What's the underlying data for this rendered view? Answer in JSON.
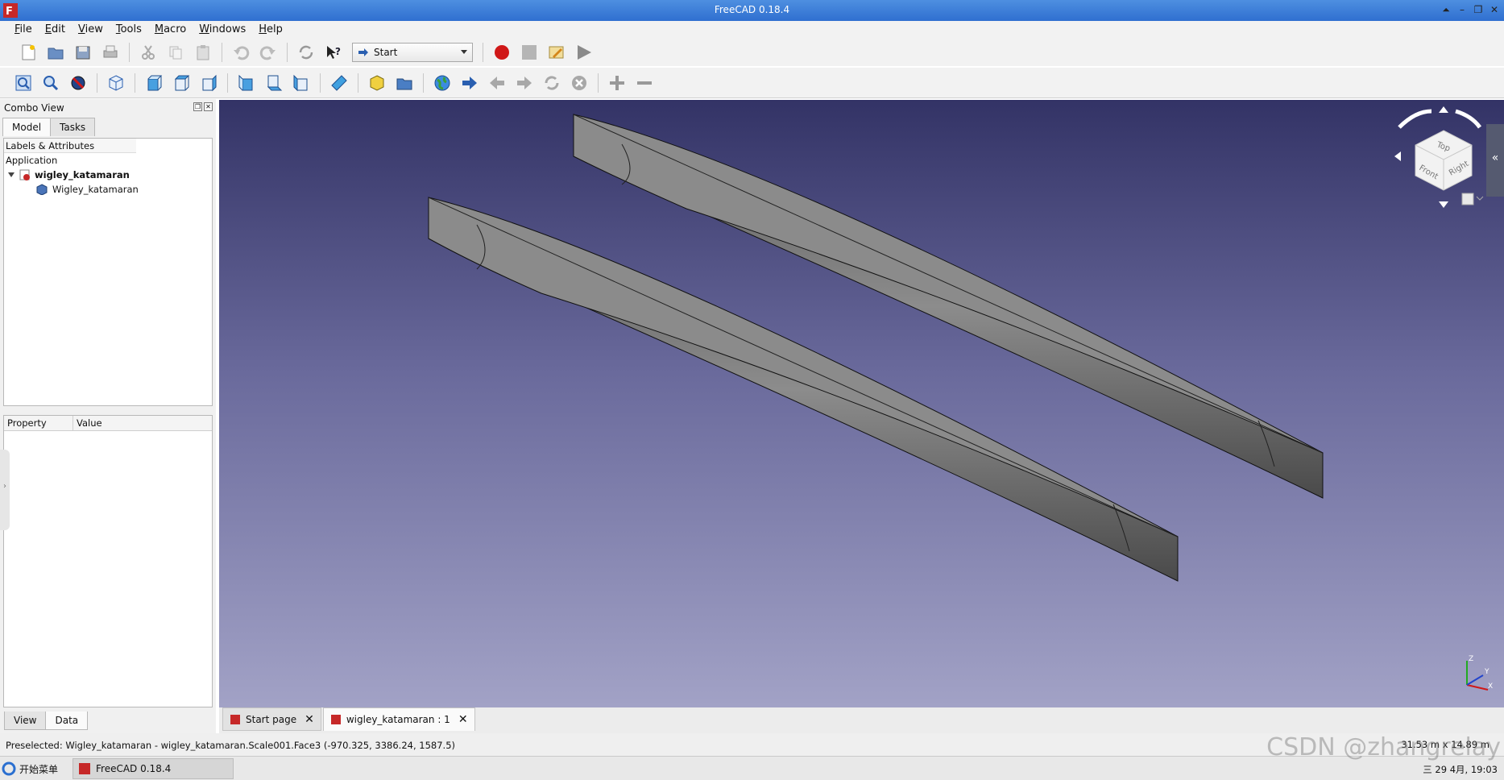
{
  "window": {
    "title": "FreeCAD 0.18.4"
  },
  "menu": [
    {
      "label": "File",
      "ul": "F",
      "rest": "ile"
    },
    {
      "label": "Edit",
      "ul": "E",
      "rest": "dit"
    },
    {
      "label": "View",
      "ul": "V",
      "rest": "iew"
    },
    {
      "label": "Tools",
      "ul": "T",
      "rest": "ools"
    },
    {
      "label": "Macro",
      "ul": "M",
      "rest": "acro"
    },
    {
      "label": "Windows",
      "ul": "W",
      "rest": "indows"
    },
    {
      "label": "Help",
      "ul": "H",
      "rest": "elp"
    }
  ],
  "workbench": {
    "selected": "Start"
  },
  "combo": {
    "title": "Combo View",
    "tabs": [
      "Model",
      "Tasks"
    ],
    "tree_header": "Labels & Attributes",
    "tree": {
      "section": "Application",
      "document": "wigley_katamaran",
      "object": "Wigley_katamaran"
    },
    "prop_headers": {
      "property": "Property",
      "value": "Value"
    },
    "bottom_tabs": [
      "View",
      "Data"
    ]
  },
  "navcube": {
    "top": "Top",
    "front": "Front",
    "right": "Right"
  },
  "axes": {
    "x": "X",
    "y": "Y",
    "z": "Z"
  },
  "doc_tabs": [
    {
      "label": "Start page"
    },
    {
      "label": "wigley_katamaran : 1"
    }
  ],
  "status": {
    "preselect": "Preselected: Wigley_katamaran - wigley_katamaran.Scale001.Face3 (-970.325, 3386.24, 1587.5)",
    "dimensions": "31.53 m x 14.89 m"
  },
  "taskbar": {
    "start": "开始菜单",
    "app": "FreeCAD 0.18.4",
    "clock": "三 29 4月, 19:03"
  },
  "watermark": "CSDN @zhangrelay",
  "colors": {
    "titlebar": "#3b7ad8",
    "viewport_top": "#333366",
    "viewport_bottom": "#a2a2c6",
    "hull": "#8a8a8a",
    "record": "#d01818"
  }
}
